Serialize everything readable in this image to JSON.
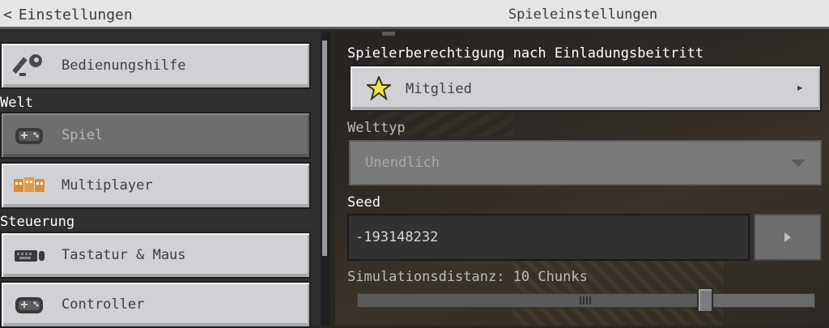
{
  "header": {
    "back_label": "Einstellungen",
    "title": "Spieleinstellungen"
  },
  "sidebar": {
    "items": [
      {
        "label": "Bedienungshilfe",
        "icon": "key-icon"
      },
      {
        "label": "Spiel",
        "icon": "gamepad-icon",
        "selected": true
      },
      {
        "label": "Multiplayer",
        "icon": "multiplayer-icon"
      },
      {
        "label": "Tastatur & Maus",
        "icon": "keyboard-icon"
      },
      {
        "label": "Controller",
        "icon": "controller-icon"
      }
    ],
    "sections": {
      "world": "Welt",
      "controls": "Steuerung"
    }
  },
  "main": {
    "permission": {
      "label": "Spielerberechtigung nach Einladungsbeitritt",
      "value": "Mitglied",
      "icon": "star-icon"
    },
    "world_type": {
      "label": "Welttyp",
      "value": "Unendlich",
      "disabled": true
    },
    "seed": {
      "label": "Seed",
      "value": "-193148232"
    },
    "simulation": {
      "label": "Simulationsdistanz: 10 Chunks",
      "value_fraction": 0.76
    }
  },
  "colors": {
    "button_bg": "#d0d1d4",
    "selected_bg": "#6e6e6e",
    "header_bg": "#e5e5e5",
    "star": "#f5e24a"
  }
}
